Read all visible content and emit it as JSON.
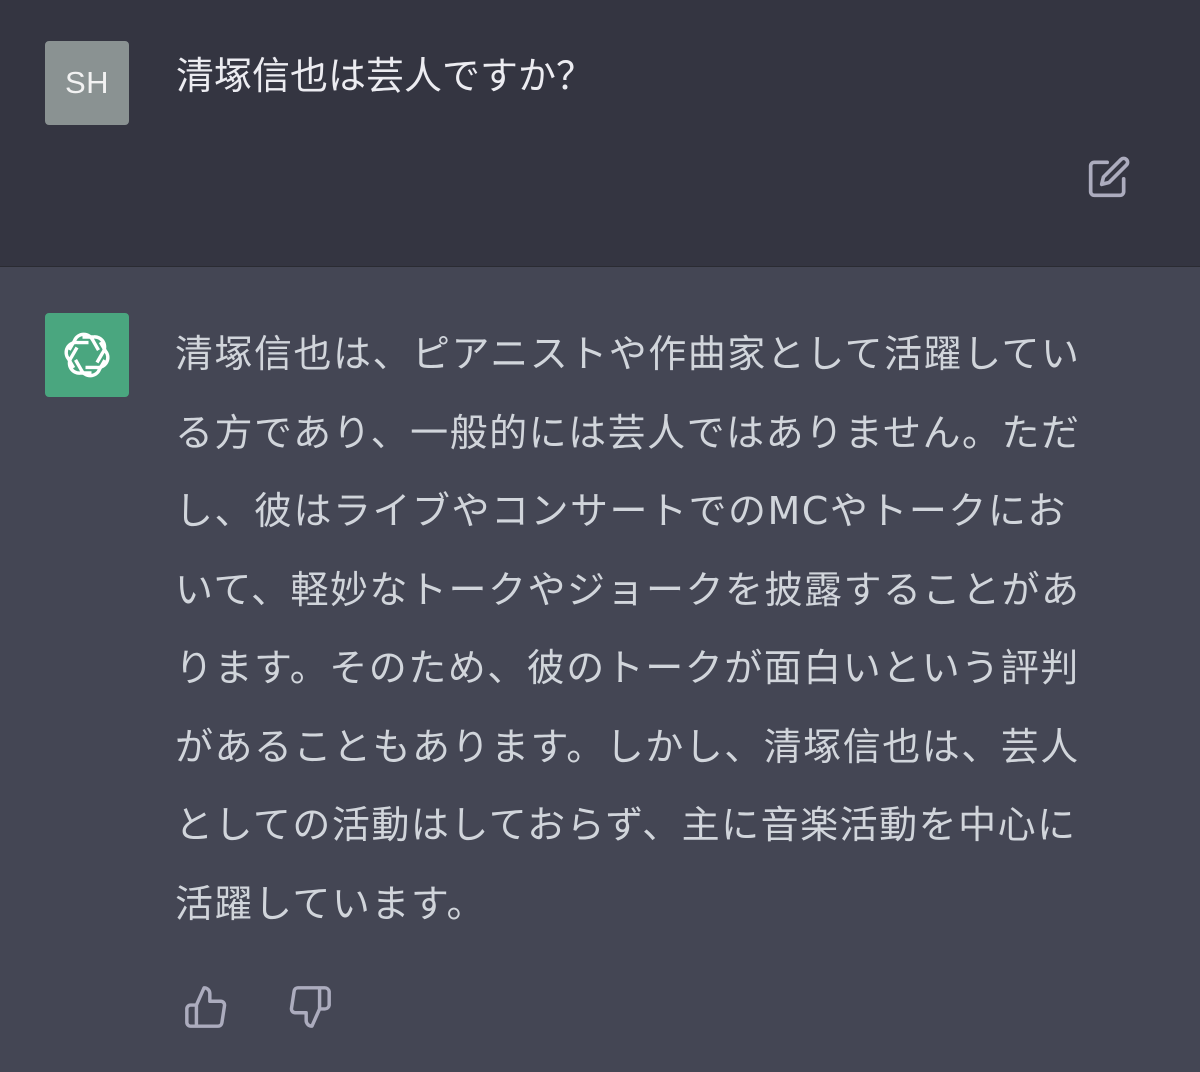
{
  "user_message": {
    "avatar_initials": "SH",
    "text": "清塚信也は芸人ですか？"
  },
  "assistant_message": {
    "icon": "openai-logo-icon",
    "lines": [
      "清塚信也は、ピアニストや作曲家として活躍してい",
      "る方であり、一般的には芸人ではありません。ただ",
      "し、彼はライブやコンサートでのMCやトークにお",
      "いて、軽妙なトークやジョークを披露することがあ",
      "ります。そのため、彼のトークが面白いという評判",
      "があることもあります。しかし、清塚信也は、芸人",
      "としての活動はしておらず、主に音楽活動を中心に",
      "活躍しています。"
    ]
  },
  "actions": {
    "edit_icon": "edit-icon",
    "thumbs_up_icon": "thumbs-up-icon",
    "thumbs_down_icon": "thumbs-down-icon"
  },
  "colors": {
    "user_bg": "#343541",
    "assistant_bg": "#444654",
    "user_avatar": "#8a9292",
    "bot_avatar": "#4aa67f",
    "text": "#d1d5db",
    "icon": "#acacbe"
  }
}
